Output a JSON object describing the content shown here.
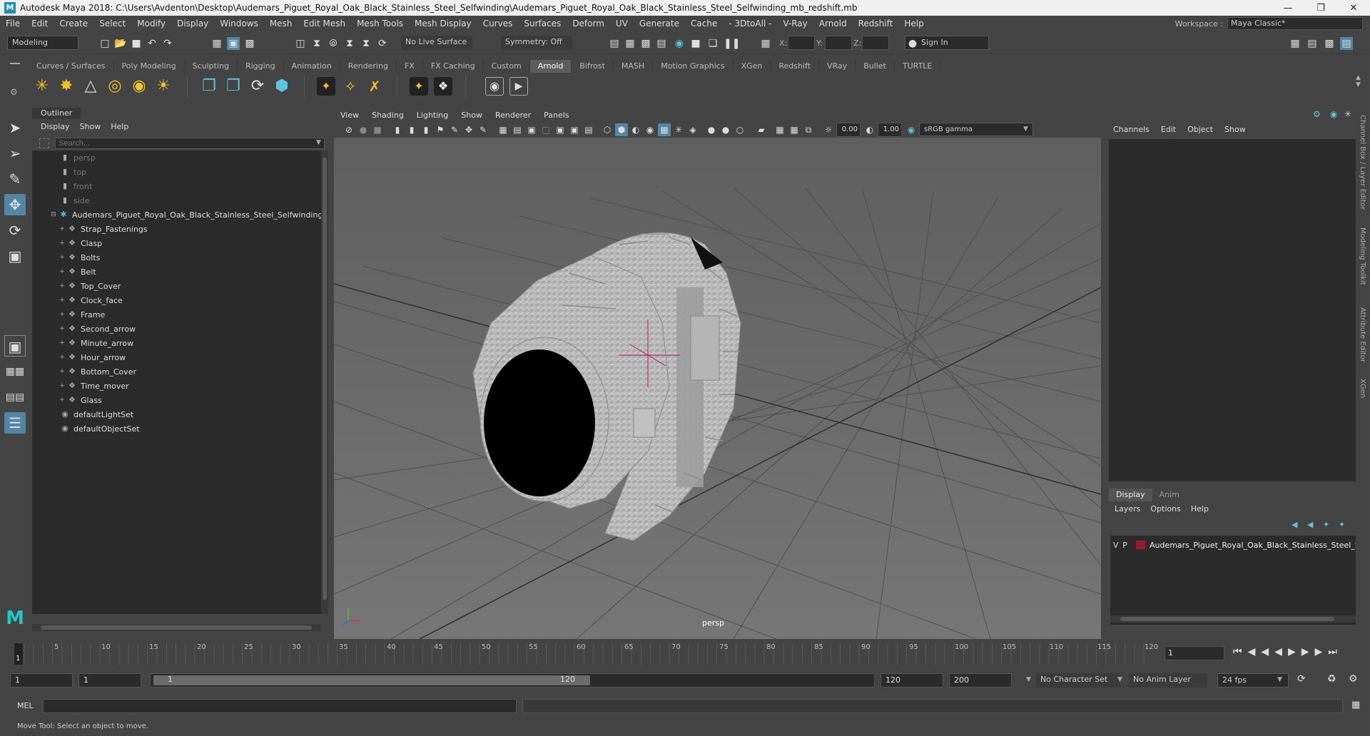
{
  "window": {
    "title": "Autodesk Maya 2018: C:\\Users\\Avdenton\\Desktop\\Audemars_Piguet_Royal_Oak_Black_Stainless_Steel_Selfwinding\\Audemars_Piguet_Royal_Oak_Black_Stainless_Steel_Selfwinding_mb_redshift.mb",
    "min": "—",
    "max": "❐",
    "close": "✕"
  },
  "menubar": [
    "File",
    "Edit",
    "Create",
    "Select",
    "Modify",
    "Display",
    "Windows",
    "Mesh",
    "Edit Mesh",
    "Mesh Tools",
    "Mesh Display",
    "Curves",
    "Surfaces",
    "Deform",
    "UV",
    "Generate",
    "Cache",
    "- 3DtoAll -",
    "V-Ray",
    "Arnold",
    "Redshift",
    "Help"
  ],
  "workspace": {
    "label": "Workspace :",
    "value": "Maya Classic*"
  },
  "statusline": {
    "mode": "Modeling",
    "live_surface": "No Live Surface",
    "symmetry": "Symmetry: Off",
    "x_label": "X:",
    "y_label": "Y:",
    "z_label": "Z:",
    "sign_in": "Sign In"
  },
  "shelf_tabs": [
    "Curves / Surfaces",
    "Poly Modeling",
    "Sculpting",
    "Rigging",
    "Animation",
    "Rendering",
    "FX",
    "FX Caching",
    "Custom",
    "Arnold",
    "Bifrost",
    "MASH",
    "Motion Graphics",
    "XGen",
    "Redshift",
    "VRay",
    "Bullet",
    "TURTLE"
  ],
  "shelf_active": "Arnold",
  "outliner": {
    "title": "Outliner",
    "menu": [
      "Display",
      "Show",
      "Help"
    ],
    "search_placeholder": "Search...",
    "cameras": [
      "persp",
      "top",
      "front",
      "side"
    ],
    "root": "Audemars_Piguet_Royal_Oak_Black_Stainless_Steel_Selfwinding_",
    "children": [
      "Strap_Fastenings",
      "Clasp",
      "Bolts",
      "Belt",
      "Top_Cover",
      "Clock_face",
      "Frame",
      "Second_arrow",
      "Minute_arrow",
      "Hour_arrow",
      "Bottom_Cover",
      "Time_mover",
      "Glass"
    ],
    "sets": [
      "defaultLightSet",
      "defaultObjectSet"
    ]
  },
  "viewport": {
    "menu": [
      "View",
      "Shading",
      "Lighting",
      "Show",
      "Renderer",
      "Panels"
    ],
    "exposure": "0.00",
    "gamma": "1.00",
    "colorspace": "sRGB gamma",
    "camera_label": "persp"
  },
  "channelbox": {
    "menu": [
      "Channels",
      "Edit",
      "Object",
      "Show"
    ],
    "side_tabs": [
      "Channel Box / Layer Editor",
      "Modeling Toolkit",
      "Attribute Editor",
      "XGen"
    ]
  },
  "layers": {
    "tabs": [
      "Display",
      "Anim"
    ],
    "menu": [
      "Layers",
      "Options",
      "Help"
    ],
    "row": {
      "v": "V",
      "p": "P",
      "name": "Audemars_Piguet_Royal_Oak_Black_Stainless_Steel_Self",
      "color": "#9a1b2f"
    }
  },
  "timeslider": {
    "ticks": [
      "1",
      "5",
      "10",
      "15",
      "20",
      "25",
      "30",
      "35",
      "40",
      "45",
      "50",
      "55",
      "60",
      "65",
      "70",
      "75",
      "80",
      "85",
      "90",
      "95",
      "100",
      "105",
      "110",
      "115",
      "120"
    ],
    "current_frame": "1"
  },
  "range": {
    "start": "1",
    "start_inner": "1",
    "slider_start": "1",
    "slider_end": "120",
    "end_inner": "120",
    "end": "200",
    "character_set": "No Character Set",
    "anim_layer": "No Anim Layer",
    "fps": "24 fps"
  },
  "cmdline": {
    "label": "MEL"
  },
  "helpline": {
    "text": "Move Tool: Select an object to move."
  },
  "colors": {
    "accent": "#5285a6",
    "viewport_bg": "#6b6b6b",
    "panel_dark": "#2b2b2b"
  }
}
